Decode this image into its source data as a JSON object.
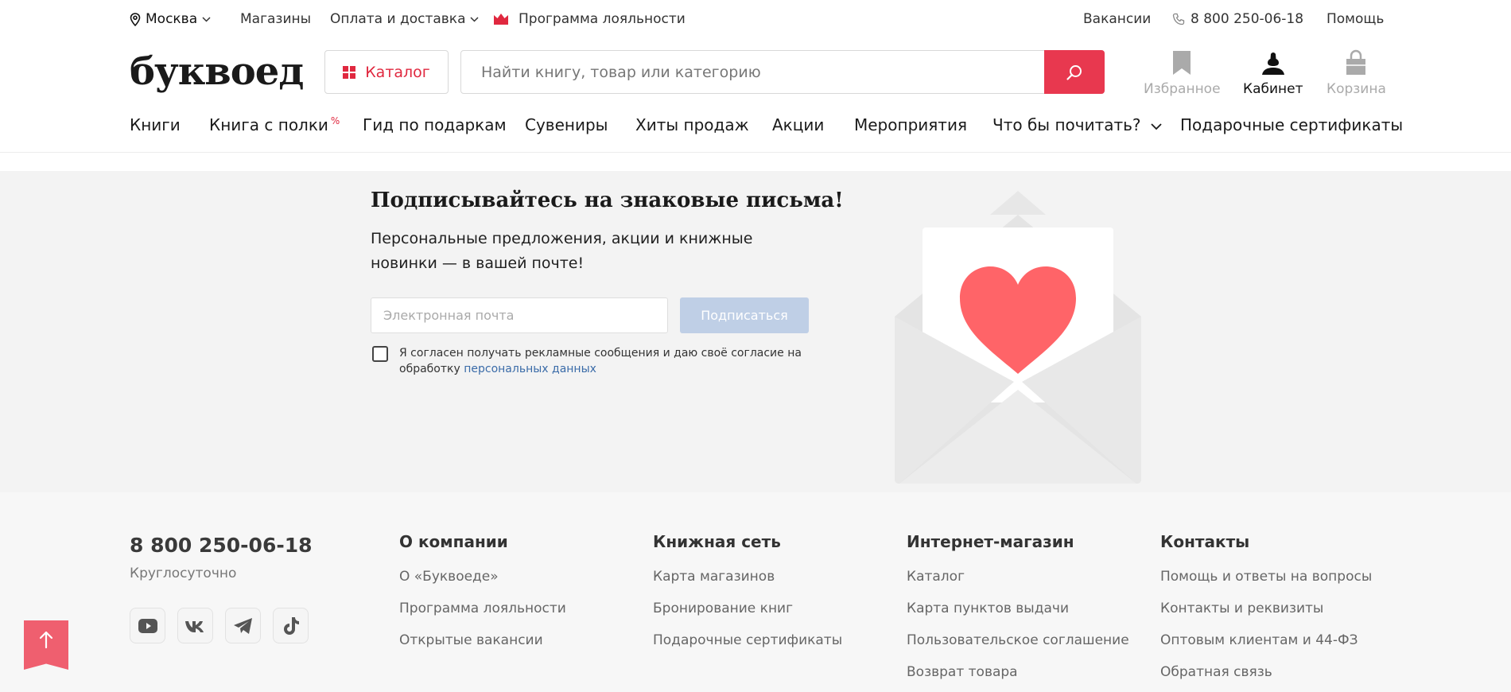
{
  "topbar": {
    "city": "Москва",
    "stores": "Магазины",
    "delivery": "Оплата и доставка",
    "loyalty": "Программа лояльности",
    "vacancies": "Вакансии",
    "phone": "8 800 250-06-18",
    "help": "Помощь"
  },
  "header": {
    "logo": "буквоед",
    "catalog_label": "Каталог",
    "search_placeholder": "Найти книгу, товар или категорию",
    "favorites": "Избранное",
    "cabinet": "Кабинет",
    "cart": "Корзина"
  },
  "nav": {
    "items": [
      "Книги",
      "Книга с полки",
      "Гид по подаркам",
      "Сувениры",
      "Хиты продаж",
      "Акции",
      "Мероприятия",
      "Что бы почитать?",
      "Подарочные сертификаты"
    ],
    "badge": "%"
  },
  "subscribe": {
    "title": "Подписывайтесь на знаковые письма!",
    "text": "Персональные предложения, акции и книжные новинки — в вашей почте!",
    "email_placeholder": "Электронная почта",
    "button": "Подписаться",
    "agree_text": "Я согласен получать рекламные сообщения и даю своё согласие на обработку",
    "agree_link": "персональных данных"
  },
  "footer": {
    "phone": "8 800 250-06-18",
    "phone_sub": "Круглосуточно",
    "social_icons": [
      "youtube-icon",
      "vk-icon",
      "telegram-icon",
      "tiktok-icon"
    ],
    "columns": [
      {
        "title": "О компании",
        "links": [
          "О «Буквоеде»",
          "Программа лояльности",
          "Открытые вакансии"
        ]
      },
      {
        "title": "Книжная сеть",
        "links": [
          "Карта магазинов",
          "Бронирование книг",
          "Подарочные сертификаты"
        ]
      },
      {
        "title": "Интернет-магазин",
        "links": [
          "Каталог",
          "Карта пунктов выдачи",
          "Пользовательское соглашение",
          "Возврат товара"
        ]
      },
      {
        "title": "Контакты",
        "links": [
          "Помощь и ответы на вопросы",
          "Контакты и реквизиты",
          "Оптовым клиентам и 44-ФЗ",
          "Обратная связь"
        ]
      }
    ]
  },
  "colors": {
    "accent": "#e8384f",
    "subscribe_bg": "#f3f3f3",
    "subscribe_button": "#bfcfe6",
    "heart": "#ff6468"
  }
}
